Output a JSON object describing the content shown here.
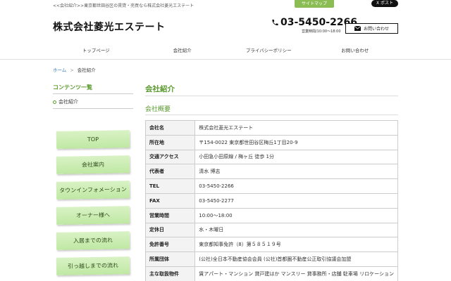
{
  "header": {
    "top_breadcrumb": "<<会社紹介>>東京都世田谷区の賃貸・売買なら株式会社菱光エステート",
    "sitemap_label": "サイトマップ",
    "x_post_label": "X ポスト",
    "logo": "株式会社菱光エステート",
    "phone": "03-5450-2266",
    "hours": "営業時間/10:00～18:00",
    "contact_label": "お問い合わせ"
  },
  "nav": {
    "items": [
      {
        "label": "トップページ"
      },
      {
        "label": "会社紹介"
      },
      {
        "label": "プライバシーポリシー"
      },
      {
        "label": "お問い合わせ"
      }
    ]
  },
  "breadcrumb": {
    "home": "ホーム",
    "sep": ">",
    "current": "会社紹介"
  },
  "sidebar": {
    "title": "コンテンツ一覧",
    "item": "会社紹介",
    "menu": [
      {
        "label": "TOP"
      },
      {
        "label": "会社案内"
      },
      {
        "label": "タウンインフォメーション"
      },
      {
        "label": "オーナー様へ"
      },
      {
        "label": "入居までの流れ"
      },
      {
        "label": "引っ越しまでの流れ"
      }
    ]
  },
  "main": {
    "title": "会社紹介",
    "subtitle": "会社概要",
    "rows": [
      {
        "k": "会社名",
        "v": "株式会社菱光エステート"
      },
      {
        "k": "所在地",
        "v": "〒154-0022 東京都世田谷区梅丘1丁目20-9"
      },
      {
        "k": "交通アクセス",
        "v": "小田急小田原線 / 梅ヶ丘 徒歩 1分"
      },
      {
        "k": "代表者",
        "v": "清水 博志"
      },
      {
        "k": "TEL",
        "v": "03-5450-2266"
      },
      {
        "k": "FAX",
        "v": "03-5450-2277"
      },
      {
        "k": "営業時間",
        "v": "10:00～18:00"
      },
      {
        "k": "定休日",
        "v": "水・木曜日"
      },
      {
        "k": "免許番号",
        "v": "東京都知事免許（8）第５８５１９号"
      },
      {
        "k": "所属団体",
        "v": "(公社)全日本不動産協会会員 (公社)首都圏不動産公正取引協議会加盟"
      },
      {
        "k": "主な取扱物件",
        "v": "賃アパート・マンション 貸戸建はか マンスリー 貸事務所・店舗 駐車場 リロケーション"
      }
    ]
  },
  "colors": {
    "accent": "#5a9a2e",
    "menu_green": "#c8eeae",
    "link": "#3a7bbf"
  }
}
